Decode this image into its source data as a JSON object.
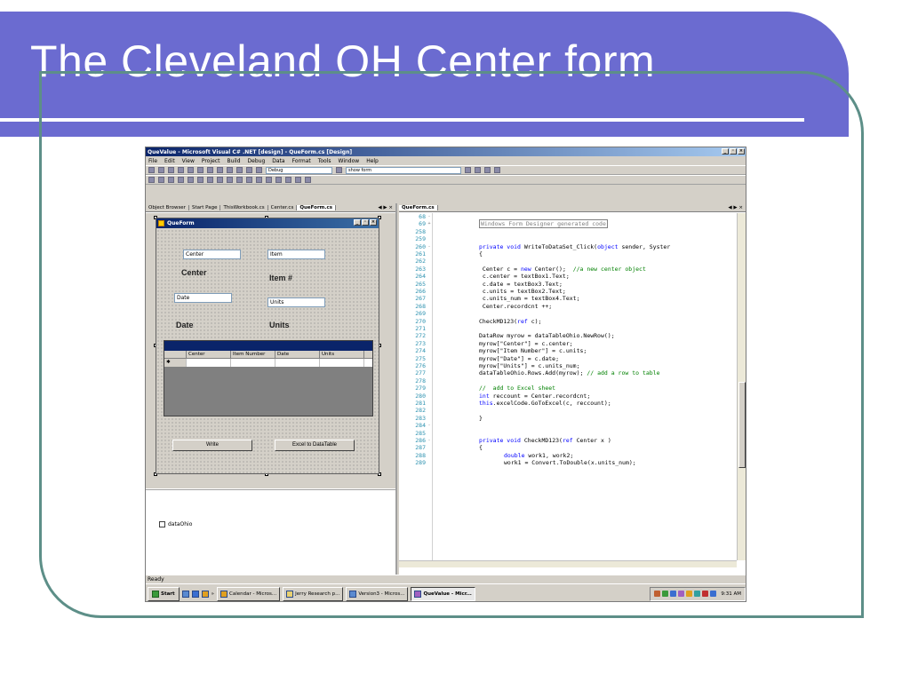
{
  "slide": {
    "title": "The Cleveland OH Center form"
  },
  "window": {
    "title": "QueValue - Microsoft Visual C# .NET [design] - QueForm.cs [Design]",
    "controls": [
      "_",
      "·",
      "×"
    ]
  },
  "menu": [
    "File",
    "Edit",
    "View",
    "Project",
    "Build",
    "Debug",
    "Data",
    "Format",
    "Tools",
    "Window",
    "Help"
  ],
  "toolbar": {
    "config": "Debug",
    "find": "show form"
  },
  "left_tabs": [
    "Object Browser",
    "Start Page",
    "ThisWorkbook.cs",
    "Center.cs",
    "QueForm.cs"
  ],
  "left_tab_arrows": "◀ ▶ ×",
  "form": {
    "title": "QueForm",
    "textboxes": {
      "center": "Center",
      "item": "Item",
      "date": "Date",
      "units": "Units"
    },
    "labels": {
      "center": "Center",
      "item": "Item #",
      "date": "Date",
      "units": "Units"
    },
    "grid_columns": [
      "Center",
      "Item Number",
      "Date",
      "Units"
    ],
    "grid_row_marker": "✱",
    "buttons": {
      "write": "Write",
      "excel": "Excel to DataTable"
    }
  },
  "tray": {
    "component": "dataOhio"
  },
  "code_tab": "QueForm.cs",
  "code_tab_arrows": "◀ ▶ ×",
  "code_lines": [
    {
      "ln": "68",
      "fold": "-",
      "text": ""
    },
    {
      "ln": "69",
      "fold": "+",
      "text": "Windows Form Designer generated code",
      "kind": "region"
    },
    {
      "ln": "258",
      "fold": "",
      "text": ""
    },
    {
      "ln": "259",
      "fold": "",
      "text": ""
    },
    {
      "ln": "260",
      "fold": "-",
      "kw": "private void",
      "text": " WriteToDataSet_Click(",
      "kw2": "object",
      "text2": " sender, Syster"
    },
    {
      "ln": "261",
      "fold": "",
      "text": "{"
    },
    {
      "ln": "262",
      "fold": "",
      "text": ""
    },
    {
      "ln": "263",
      "fold": "",
      "text": " Center c = ",
      "kw2": "new",
      "text2": " Center();  ",
      "comment": "//a new center object"
    },
    {
      "ln": "264",
      "fold": "",
      "text": " c.center = textBox1.Text;"
    },
    {
      "ln": "265",
      "fold": "",
      "text": " c.date = textBox3.Text;"
    },
    {
      "ln": "266",
      "fold": "",
      "text": " c.units = textBox2.Text;"
    },
    {
      "ln": "267",
      "fold": "",
      "text": " c.units_num = textBox4.Text;"
    },
    {
      "ln": "268",
      "fold": "",
      "text": " Center.recordcnt ++;"
    },
    {
      "ln": "269",
      "fold": "",
      "text": ""
    },
    {
      "ln": "270",
      "fold": "",
      "text": "CheckMD123(",
      "kw2": "ref",
      "text2": " c);"
    },
    {
      "ln": "271",
      "fold": "",
      "text": ""
    },
    {
      "ln": "272",
      "fold": "",
      "text": "DataRow myrow = dataTableOhio.NewRow();"
    },
    {
      "ln": "273",
      "fold": "",
      "text": "myrow[\"Center\"] = c.center;"
    },
    {
      "ln": "274",
      "fold": "",
      "text": "myrow[\"Item Number\"] = c.units;"
    },
    {
      "ln": "275",
      "fold": "",
      "text": "myrow[\"Date\"] = c.date;"
    },
    {
      "ln": "276",
      "fold": "",
      "text": "myrow[\"Units\"] = c.units_num;"
    },
    {
      "ln": "277",
      "fold": "",
      "text": "dataTableOhio.Rows.Add(myrow); ",
      "comment": "// add a row to table"
    },
    {
      "ln": "278",
      "fold": "",
      "text": ""
    },
    {
      "ln": "279",
      "fold": "",
      "text": "",
      "comment": "//  add to Excel sheet"
    },
    {
      "ln": "280",
      "fold": "",
      "kw": "int",
      "text": " reccount = Center.recordcnt;"
    },
    {
      "ln": "281",
      "fold": "",
      "kw": "this",
      "text": ".excelCode.GoToExcel(c, reccount);"
    },
    {
      "ln": "282",
      "fold": "",
      "text": ""
    },
    {
      "ln": "283",
      "fold": "",
      "text": "}"
    },
    {
      "ln": "284",
      "fold": "-",
      "text": ""
    },
    {
      "ln": "285",
      "fold": "",
      "text": ""
    },
    {
      "ln": "286",
      "fold": "-",
      "kw": "private void",
      "text": " CheckMD123(",
      "kw2": "ref",
      "text2": " Center x )"
    },
    {
      "ln": "287",
      "fold": "",
      "text": "{"
    },
    {
      "ln": "288",
      "fold": "",
      "indent": true,
      "kw": "double",
      "text": " work1, work2;"
    },
    {
      "ln": "289",
      "fold": "",
      "indent": true,
      "text": "work1 = Convert.ToDouble(x.units_num);"
    }
  ],
  "status": "Ready",
  "taskbar": {
    "start": "Start",
    "chevron": "»",
    "items": [
      {
        "label": "Calendar - Micros...",
        "active": false
      },
      {
        "label": "Jerry Research p...",
        "active": false
      },
      {
        "label": "Version3 - Micros...",
        "active": false
      },
      {
        "label": "QueValue - Micr...",
        "active": true
      }
    ],
    "clock": "9:31 AM"
  },
  "colors": {
    "title_band": "#6b6bd0",
    "frame": "#5d8f88",
    "code_keyword": "#0000ff",
    "code_comment": "#008000",
    "line_number": "#2b91af"
  }
}
